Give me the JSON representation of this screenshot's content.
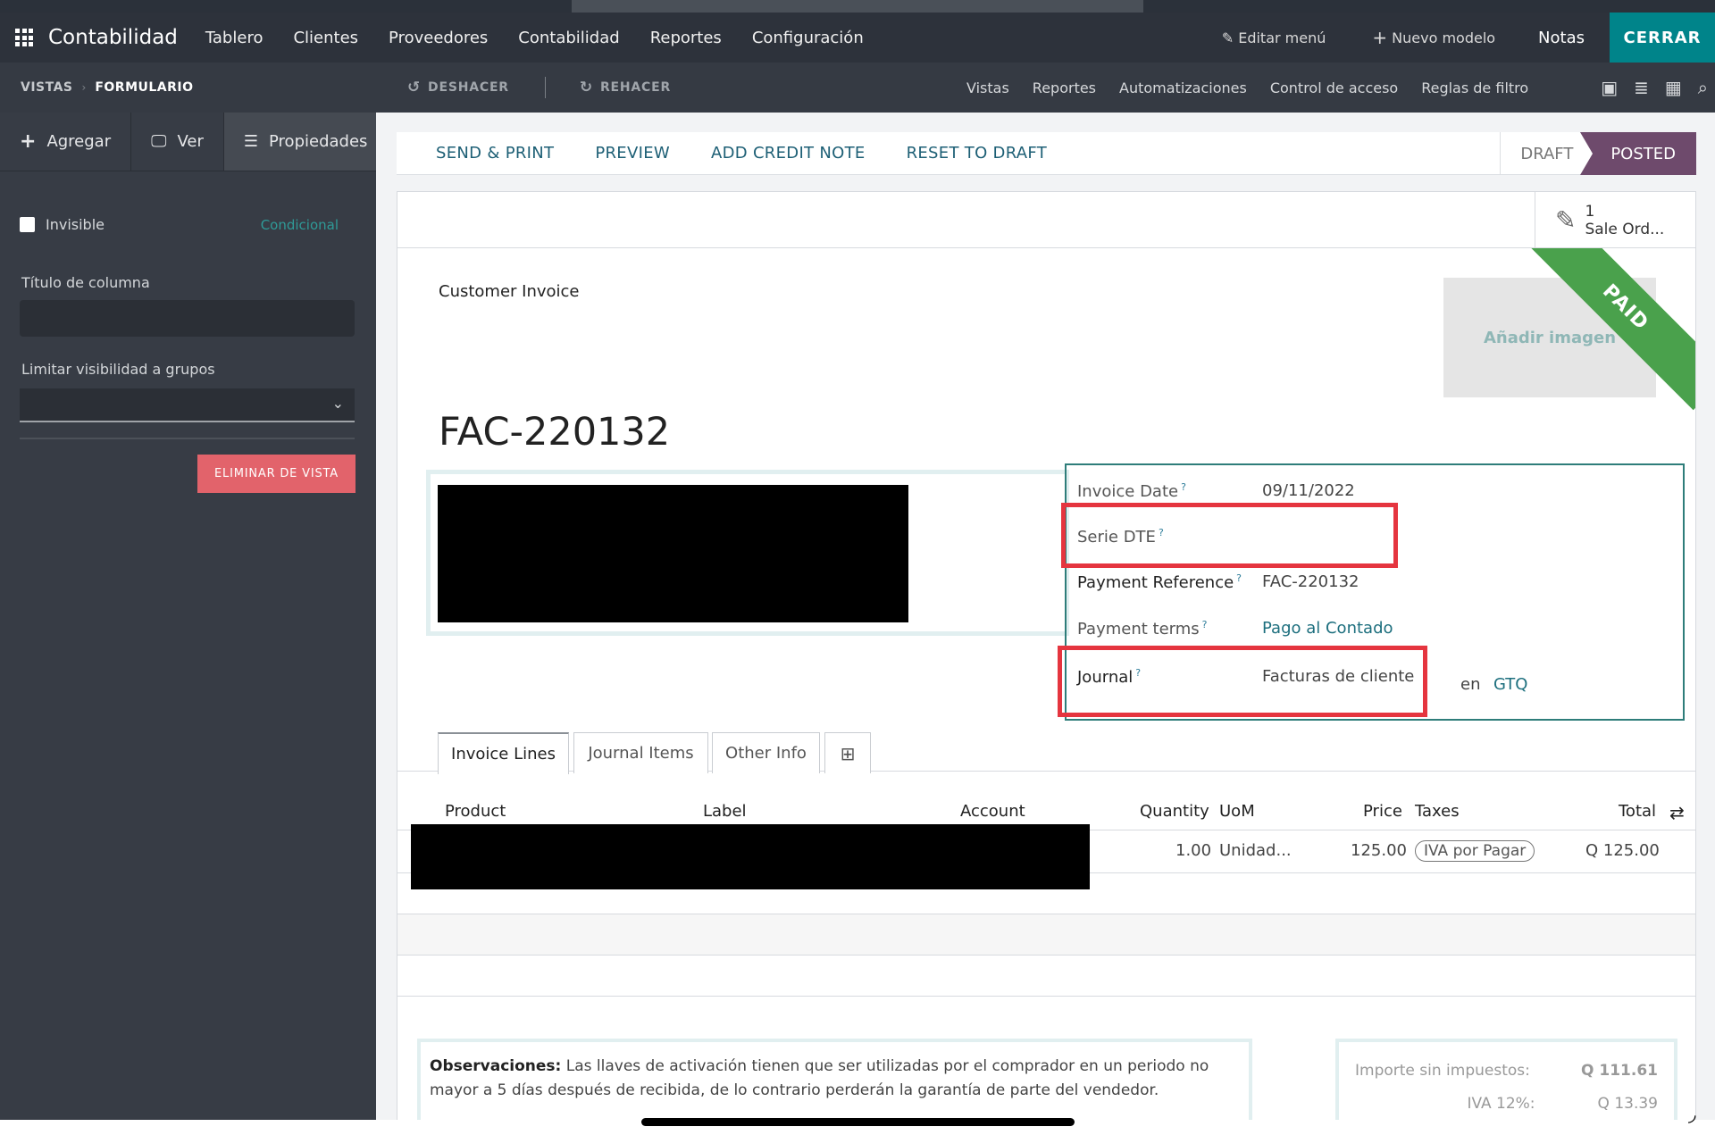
{
  "navbar": {
    "brand": "Contabilidad",
    "menu": [
      "Tablero",
      "Clientes",
      "Proveedores",
      "Contabilidad",
      "Reportes",
      "Configuración"
    ],
    "edit_menu": "Editar menú",
    "new_model": "Nuevo modelo",
    "notes": "Notas",
    "close": "CERRAR"
  },
  "subbar": {
    "breadcrumb_root": "VISTAS",
    "breadcrumb_current": "FORMULARIO",
    "undo": "DESHACER",
    "redo": "REHACER",
    "links": [
      "Vistas",
      "Reportes",
      "Automatizaciones",
      "Control de acceso",
      "Reglas de filtro"
    ]
  },
  "sidebar": {
    "tabs": [
      {
        "icon": "+",
        "label": "Agregar"
      },
      {
        "icon": "🖵",
        "label": "Ver"
      },
      {
        "icon": "☰",
        "label": "Propiedades"
      }
    ],
    "invisible_label": "Invisible",
    "conditional_link": "Condicional",
    "column_title_label": "Título de columna",
    "column_title_value": "",
    "groups_label": "Limitar visibilidad a grupos",
    "groups_value": "",
    "delete_button": "ELIMINAR DE VISTA"
  },
  "statusbar": {
    "actions": [
      "SEND & PRINT",
      "PREVIEW",
      "ADD CREDIT NOTE",
      "RESET TO DRAFT"
    ],
    "stages": [
      "DRAFT",
      "POSTED"
    ],
    "active_stage": "POSTED"
  },
  "smart_button": {
    "count": "1",
    "label": "Sale Ord..."
  },
  "invoice": {
    "type": "Customer Invoice",
    "add_image": "Añadir imagen",
    "ribbon": "PAID",
    "name": "FAC-220132",
    "fields": {
      "invoice_date_label": "Invoice Date",
      "invoice_date": "09/11/2022",
      "serie_dte_label": "Serie DTE",
      "serie_dte": "",
      "payment_reference_label": "Payment Reference",
      "payment_reference": "FAC-220132",
      "payment_terms_label": "Payment terms",
      "payment_terms": "Pago al Contado",
      "journal_label": "Journal",
      "journal": "Facturas de cliente",
      "currency_prefix": "en",
      "currency": "GTQ",
      "help_mark": "?"
    }
  },
  "tabs": [
    "Invoice Lines",
    "Journal Items",
    "Other Info"
  ],
  "lines": {
    "columns": [
      "Product",
      "Label",
      "Account",
      "Quantity",
      "UoM",
      "Price",
      "Taxes",
      "Total"
    ],
    "rows": [
      {
        "quantity": "1.00",
        "uom": "Unidad...",
        "price": "125.00",
        "tax": "IVA por Pagar",
        "total": "Q 125.00"
      }
    ]
  },
  "notes": {
    "label": "Observaciones:",
    "text": " Las llaves de activación tienen que ser utilizadas por el comprador en un periodo no mayor a 5 días después de recibida, de lo contrario perderán la garantía de parte del vendedor."
  },
  "totals": {
    "untaxed_label": "Importe sin impuestos:",
    "untaxed_value": "Q 111.61",
    "iva_label": "IVA 12%:",
    "iva_value": "Q 13.39"
  },
  "colors": {
    "navbar": "#2d323b",
    "close_button": "#00848a",
    "posted_stage": "#6e4a6c",
    "paid_ribbon": "#4aa14c",
    "highlight": "#e5353f",
    "link": "#1d6f7e"
  }
}
